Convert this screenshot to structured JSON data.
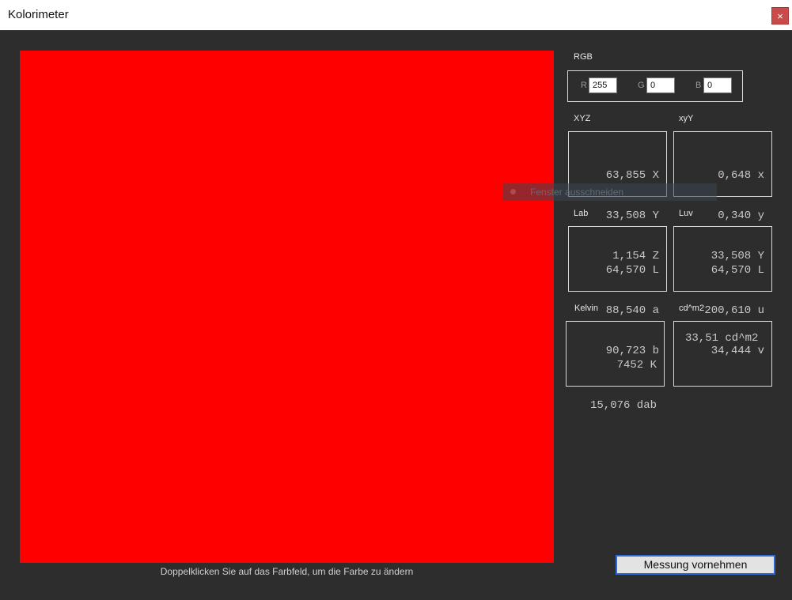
{
  "window": {
    "title": "Kolorimeter",
    "close_glyph": "×"
  },
  "swatch": {
    "color": "#ff0000",
    "hint": "Doppelklicken Sie auf das Farbfeld, um die Farbe zu ändern"
  },
  "rgb": {
    "label": "RGB",
    "r_label": "R",
    "r_value": "255",
    "g_label": "G",
    "g_value": "0",
    "b_label": "B",
    "b_value": "0"
  },
  "xyz": {
    "label": "XYZ",
    "lines": [
      "63,855 X",
      "33,508 Y",
      "1,154 Z"
    ]
  },
  "xyY": {
    "label": "xyY",
    "lines": [
      "0,648 x",
      "0,340 y",
      "33,508 Y"
    ]
  },
  "lab": {
    "label": "Lab",
    "lines": [
      "64,570 L",
      "88,540 a",
      "90,723 b"
    ]
  },
  "luv": {
    "label": "Luv",
    "lines": [
      "64,570 L",
      "200,610 u",
      "34,444 v"
    ]
  },
  "kelvin": {
    "label": "Kelvin",
    "lines": [
      "7452 K",
      "15,076 dab"
    ]
  },
  "luminance": {
    "label": "cd^m2",
    "lines": [
      "33,51 cd^m2"
    ]
  },
  "tooltip": {
    "text": "Fenster ausschneiden"
  },
  "actions": {
    "measure_label": "Messung vornehmen"
  }
}
